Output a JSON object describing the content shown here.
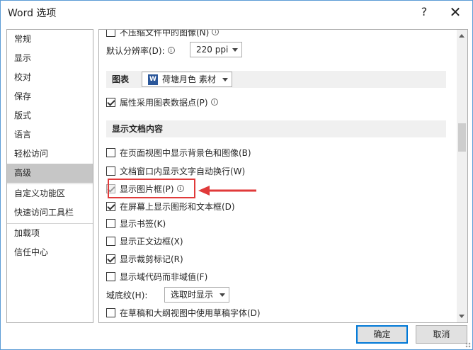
{
  "window": {
    "title": "Word 选项",
    "help": "?",
    "close": "✕"
  },
  "sidebar": {
    "items": [
      {
        "label": "常规"
      },
      {
        "label": "显示"
      },
      {
        "label": "校对"
      },
      {
        "label": "保存"
      },
      {
        "label": "版式"
      },
      {
        "label": "语言"
      },
      {
        "label": "轻松访问"
      },
      {
        "label": "高级",
        "active": true
      },
      {
        "label": "自定义功能区"
      },
      {
        "label": "快速访问工具栏"
      },
      {
        "label": "加载项"
      },
      {
        "label": "信任中心"
      }
    ]
  },
  "content": {
    "top_row": {
      "label": "不压缩文件中的图像(N)",
      "checked": false
    },
    "resolution": {
      "label": "默认分辨率(D):",
      "value": "220 ppi"
    },
    "charts_section": {
      "title": "图表",
      "doc_select": "荷塘月色  素材",
      "doc_icon": "W",
      "option": {
        "label": "属性采用图表数据点(P)",
        "checked": true
      }
    },
    "display_section": {
      "title": "显示文档内容",
      "options": [
        {
          "label": "在页面视图中显示背景色和图像(B)",
          "checked": false
        },
        {
          "label": "文档窗口内显示文字自动换行(W)",
          "checked": false
        },
        {
          "label": "显示图片框(P)",
          "checked": true,
          "disabled": true
        },
        {
          "label": "在屏幕上显示图形和文本框(D)",
          "checked": true
        },
        {
          "label": "显示书签(K)",
          "checked": false
        },
        {
          "label": "显示正文边框(X)",
          "checked": false
        },
        {
          "label": "显示裁剪标记(R)",
          "checked": true
        },
        {
          "label": "显示域代码而非域值(F)",
          "checked": false
        }
      ],
      "field_shading": {
        "label": "域底纹(H):",
        "value": "选取时显示"
      },
      "last_option": {
        "label": "在草稿和大纲视图中使用草稿字体(D)",
        "checked": false
      }
    }
  },
  "footer": {
    "ok_label": "确定",
    "cancel_label": "取消"
  },
  "colors": {
    "accent": "#0078d7",
    "highlight": "#e03a3a",
    "active_item": "#c6c6c6"
  }
}
